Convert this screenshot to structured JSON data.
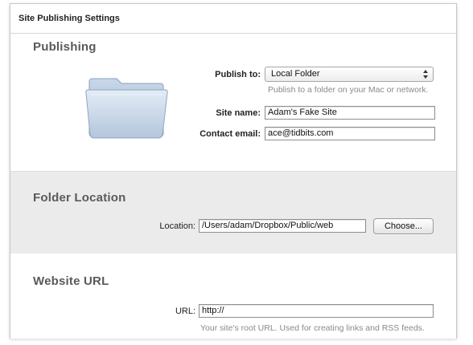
{
  "window": {
    "title": "Site Publishing Settings"
  },
  "publishing": {
    "heading": "Publishing",
    "folder_icon": "folder-icon",
    "publish_to_label": "Publish to:",
    "publish_to_value": "Local Folder",
    "publish_to_hint": "Publish to a folder on your Mac or network.",
    "site_name_label": "Site name:",
    "site_name_value": "Adam's Fake Site",
    "contact_email_label": "Contact email:",
    "contact_email_value": "ace@tidbits.com"
  },
  "folder_location": {
    "heading": "Folder Location",
    "location_label": "Location:",
    "location_value": "/Users/adam/Dropbox/Public/web",
    "choose_button": "Choose..."
  },
  "website_url": {
    "heading": "Website URL",
    "url_label": "URL:",
    "url_value": "http://",
    "url_hint": "Your site's root URL. Used for creating links and RSS feeds."
  },
  "colors": {
    "section_heading": "#5a5a5a",
    "folder_band": "#ebebeb",
    "hint_text": "#8a8a8a"
  }
}
